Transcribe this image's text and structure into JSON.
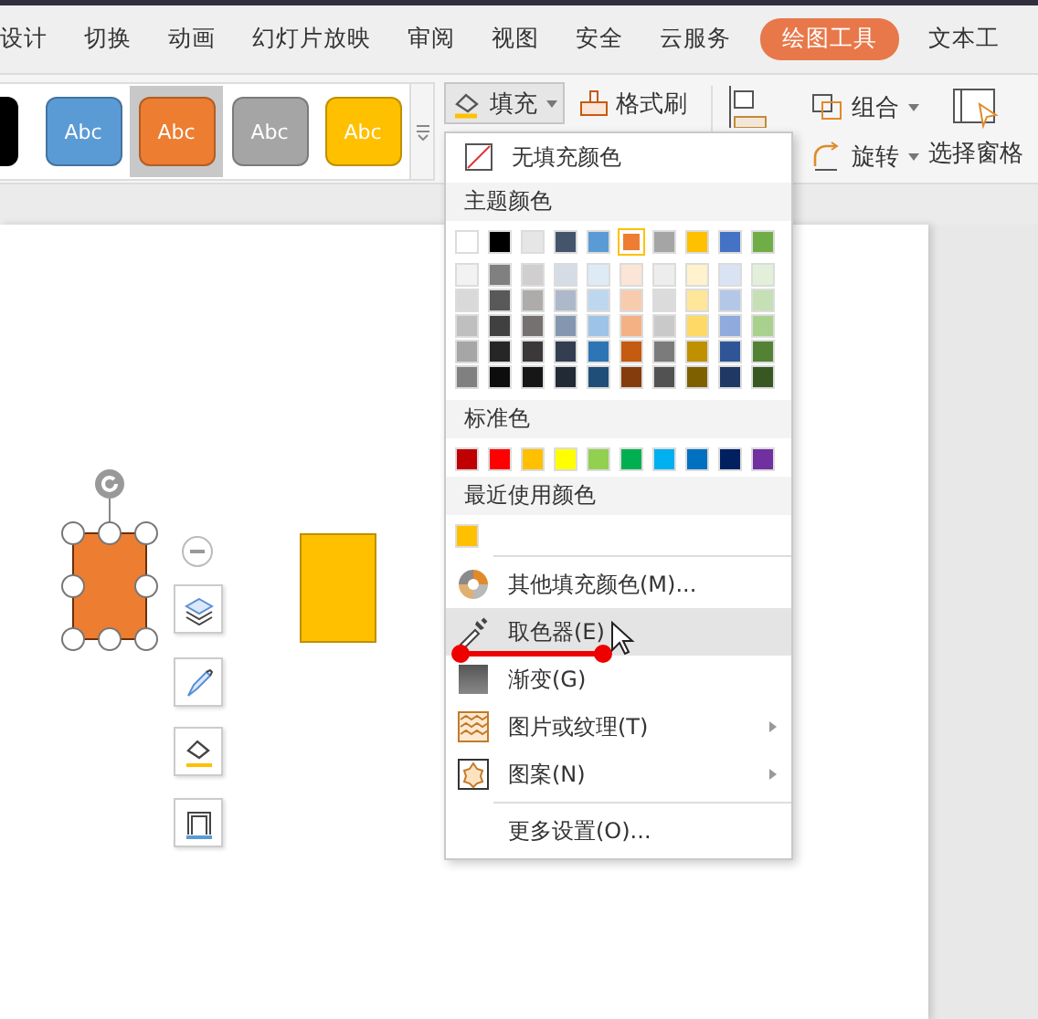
{
  "tabs": [
    {
      "label": "设计",
      "selected": false
    },
    {
      "label": "切换",
      "selected": false
    },
    {
      "label": "动画",
      "selected": false
    },
    {
      "label": "幻灯片放映",
      "selected": false
    },
    {
      "label": "审阅",
      "selected": false
    },
    {
      "label": "视图",
      "selected": false
    },
    {
      "label": "安全",
      "selected": false
    },
    {
      "label": "云服务",
      "selected": false
    },
    {
      "label": "绘图工具",
      "selected": true
    },
    {
      "label": "文本工",
      "selected": false
    }
  ],
  "style_gallery": [
    {
      "color": "#000000",
      "selected": false
    },
    {
      "label": "Abc",
      "color": "#5b9bd5",
      "selected": false
    },
    {
      "label": "Abc",
      "color": "#ed7d31",
      "selected": true
    },
    {
      "label": "Abc",
      "color": "#a5a5a5",
      "selected": false
    },
    {
      "label": "Abc",
      "color": "#ffc000",
      "selected": false
    }
  ],
  "ribbon": {
    "fill": "填充",
    "format_painter": "格式刷",
    "group": "组合",
    "rotate": "旋转",
    "selection_pane": "选择窗格"
  },
  "fill_menu": {
    "no_fill": "无填充颜色",
    "theme_header": "主题颜色",
    "theme_colors": [
      {
        "color": "#ffffff",
        "selected": false
      },
      {
        "color": "#000000",
        "selected": false
      },
      {
        "color": "#e7e6e6",
        "selected": false
      },
      {
        "color": "#44546a",
        "selected": false
      },
      {
        "color": "#5b9bd5",
        "selected": false
      },
      {
        "color": "#ed7d31",
        "selected": true
      },
      {
        "color": "#a5a5a5",
        "selected": false
      },
      {
        "color": "#ffc000",
        "selected": false
      },
      {
        "color": "#4472c4",
        "selected": false
      },
      {
        "color": "#70ad47",
        "selected": false
      }
    ],
    "shade_rows": [
      {
        "colors": [
          {
            "color": "#f2f2f2"
          },
          {
            "color": "#808080"
          },
          {
            "color": "#d0cece"
          },
          {
            "color": "#d6dce5"
          },
          {
            "color": "#deebf7"
          },
          {
            "color": "#fbe5d6"
          },
          {
            "color": "#ededed"
          },
          {
            "color": "#fff2cc"
          },
          {
            "color": "#dae3f3"
          },
          {
            "color": "#e2f0d9"
          }
        ]
      },
      {
        "colors": [
          {
            "color": "#d9d9d9"
          },
          {
            "color": "#595959"
          },
          {
            "color": "#aeabab"
          },
          {
            "color": "#adb9ca"
          },
          {
            "color": "#bdd7ee"
          },
          {
            "color": "#f8cbad"
          },
          {
            "color": "#dbdbdb"
          },
          {
            "color": "#ffe699"
          },
          {
            "color": "#b4c7e7"
          },
          {
            "color": "#c5e0b4"
          }
        ]
      },
      {
        "colors": [
          {
            "color": "#bfbfbf"
          },
          {
            "color": "#404040"
          },
          {
            "color": "#757171"
          },
          {
            "color": "#8497b0"
          },
          {
            "color": "#9dc3e6"
          },
          {
            "color": "#f4b183"
          },
          {
            "color": "#c9c9c9"
          },
          {
            "color": "#ffd966"
          },
          {
            "color": "#8faadc"
          },
          {
            "color": "#a9d18e"
          }
        ]
      },
      {
        "colors": [
          {
            "color": "#a6a6a6"
          },
          {
            "color": "#262626"
          },
          {
            "color": "#3a3838"
          },
          {
            "color": "#333f50"
          },
          {
            "color": "#2e75b6"
          },
          {
            "color": "#c55a11"
          },
          {
            "color": "#7b7b7b"
          },
          {
            "color": "#bf9000"
          },
          {
            "color": "#2f5597"
          },
          {
            "color": "#548235"
          }
        ]
      },
      {
        "colors": [
          {
            "color": "#808080"
          },
          {
            "color": "#0d0d0d"
          },
          {
            "color": "#171616"
          },
          {
            "color": "#222a35"
          },
          {
            "color": "#1f4e79"
          },
          {
            "color": "#843c0c"
          },
          {
            "color": "#525252"
          },
          {
            "color": "#7f6000"
          },
          {
            "color": "#203864"
          },
          {
            "color": "#385723"
          }
        ]
      }
    ],
    "standard_header": "标准色",
    "standard_colors": [
      {
        "color": "#c00000"
      },
      {
        "color": "#ff0000"
      },
      {
        "color": "#ffc000"
      },
      {
        "color": "#ffff00"
      },
      {
        "color": "#92d050"
      },
      {
        "color": "#00b050"
      },
      {
        "color": "#00b0f0"
      },
      {
        "color": "#0070c0"
      },
      {
        "color": "#002060"
      },
      {
        "color": "#7030a0"
      }
    ],
    "recent_header": "最近使用颜色",
    "recent_colors": [
      {
        "color": "#ffc000"
      }
    ],
    "actions": [
      {
        "label": "其他填充颜色(M)...",
        "highlighted": false,
        "submenu": false
      },
      {
        "label": "取色器(E)",
        "highlighted": true,
        "submenu": false
      },
      {
        "label": "渐变(G)",
        "highlighted": false,
        "submenu": false
      },
      {
        "label": "图片或纹理(T)",
        "highlighted": false,
        "submenu": true
      },
      {
        "label": "图案(N)",
        "highlighted": false,
        "submenu": true
      }
    ],
    "more": "更多设置(O)..."
  }
}
